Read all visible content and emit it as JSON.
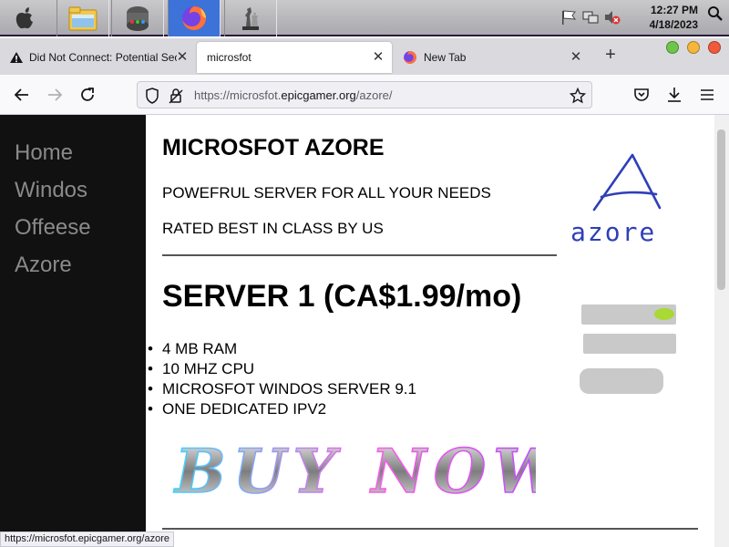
{
  "taskbar": {
    "time": "12:27 PM",
    "date": "4/18/2023"
  },
  "tabs": [
    {
      "label": "Did Not Connect: Potential Sec"
    },
    {
      "label": "microsfot"
    },
    {
      "label": "New Tab"
    }
  ],
  "tab_close_glyph": "✕",
  "new_tab_glyph": "+",
  "urlbar": {
    "prefix": "https://microsfot.",
    "domain": "epicgamer.org",
    "path": "/azore/"
  },
  "page": {
    "nav": [
      "Home",
      "Windos",
      "Offeese",
      "Azore"
    ],
    "title": "MICROSFOT AZORE",
    "tagline1": "POWEFRUL SERVER FOR ALL YOUR NEEDS",
    "tagline2": "RATED BEST IN CLASS BY US",
    "server_heading": "SERVER 1 (CA$1.99/mo)",
    "specs": [
      "4 MB RAM",
      "10 MHZ CPU",
      "MICROSFOT WINDOS SERVER 9.1",
      "ONE DEDICATED IPV2"
    ],
    "buy_text": "BUY NOW",
    "logo_letter": "A",
    "logo_word": "azore"
  },
  "status_url": "https://microsfot.epicgamer.org/azore",
  "colors": {
    "sidebar": "#111111",
    "taskbar_active": "#3d72d8"
  }
}
